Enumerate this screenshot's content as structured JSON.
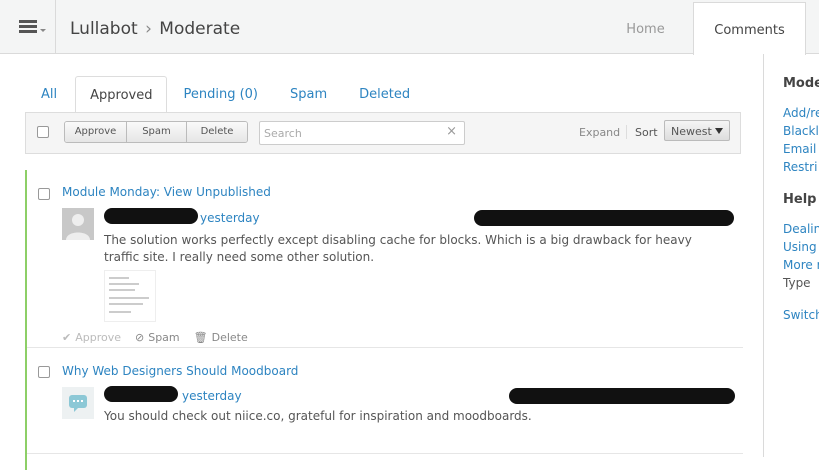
{
  "header": {
    "site": "Lullabot",
    "separator": "›",
    "section": "Moderate",
    "nav": [
      {
        "label": "Home"
      },
      {
        "label": "Comments",
        "active": true
      }
    ]
  },
  "filters": {
    "tabs": [
      {
        "label": "All"
      },
      {
        "label": "Approved",
        "active": true
      },
      {
        "label": "Pending (0)"
      },
      {
        "label": "Spam"
      },
      {
        "label": "Deleted"
      }
    ]
  },
  "toolbar": {
    "buttons": [
      "Approve",
      "Spam",
      "Delete"
    ],
    "search_placeholder": "Search",
    "search_clear": "×",
    "expand": "Expand",
    "sort_label": "Sort",
    "sort_value": "Newest"
  },
  "comments": [
    {
      "thread": "Module Monday: View Unpublished",
      "time": "yesterday",
      "body": "The solution works perfectly except disabling cache for blocks. Which is a big drawback for heavy traffic site. I really need some other solution.",
      "actions": [
        "Approve",
        "Spam",
        "Delete"
      ]
    },
    {
      "thread": "Why Web Designers Should Moodboard",
      "time": "yesterday",
      "body": "You should check out niice.co, grateful for inspiration and moodboards."
    }
  ],
  "sidebar": {
    "moderate_heading": "Mode",
    "moderate_links": [
      "Add/re",
      "Blackl",
      "Email",
      "Restri"
    ],
    "help_heading": "Help",
    "help_links": [
      "Dealin",
      "Using",
      "More r"
    ],
    "help_text": "Type",
    "switch_link": "Switch"
  },
  "colors": {
    "link": "#2d84c1",
    "approved_bar": "#8dcf67"
  }
}
